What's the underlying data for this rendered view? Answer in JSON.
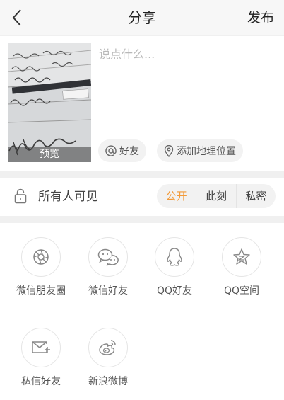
{
  "header": {
    "title": "分享",
    "publish_label": "发布"
  },
  "compose": {
    "placeholder": "说点什么...",
    "preview_label": "预览",
    "mention_label": "好友",
    "location_label": "添加地理位置"
  },
  "visibility": {
    "label": "所有人可见",
    "options": [
      "公开",
      "此刻",
      "私密"
    ],
    "selected": "公开"
  },
  "share": {
    "items": [
      {
        "label": "微信朋友圈",
        "icon": "wechat-moments-icon"
      },
      {
        "label": "微信好友",
        "icon": "wechat-icon"
      },
      {
        "label": "QQ好友",
        "icon": "qq-icon"
      },
      {
        "label": "QQ空间",
        "icon": "qzone-icon"
      },
      {
        "label": "私信好友",
        "icon": "mail-plus-icon"
      },
      {
        "label": "新浪微博",
        "icon": "weibo-icon"
      }
    ]
  },
  "colors": {
    "accent": "#f39a38",
    "icon": "#888888"
  }
}
